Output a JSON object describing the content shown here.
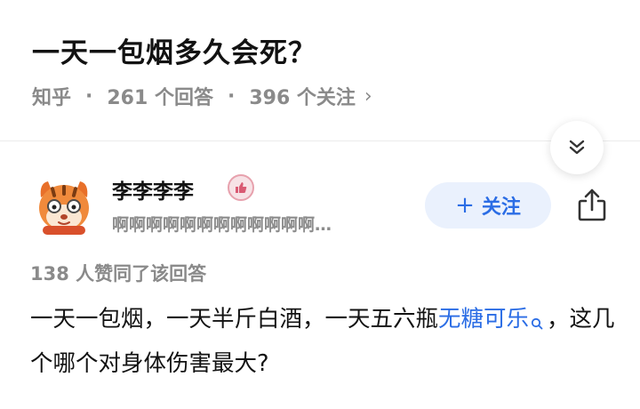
{
  "question": {
    "title": "一天一包烟多久会死？",
    "source": "知乎",
    "dot": "·",
    "answer_count": "261 个回答",
    "follower_count": "396 个关注",
    "chevron": "›"
  },
  "author": {
    "name": "李李李李",
    "bio": "啊啊啊啊啊啊啊啊啊啊啊啊…",
    "follow_label": "关注",
    "follow_plus": "+"
  },
  "answer": {
    "votes": "138 人赞同了该回答",
    "text_part1": "一天一包烟，一天半斤白酒，一天五六瓶",
    "link_text": "无糖可乐",
    "text_part2": "，这几个哪个对身体伤害最大?"
  },
  "icons": {
    "expand": "double-chevron-down-icon",
    "share": "share-icon",
    "badge": "thumbs-up-badge-icon",
    "search": "search-icon"
  },
  "colors": {
    "link": "#2b6de5",
    "follow_bg": "#eaf1fd",
    "meta_gray": "#8a8a8a"
  }
}
